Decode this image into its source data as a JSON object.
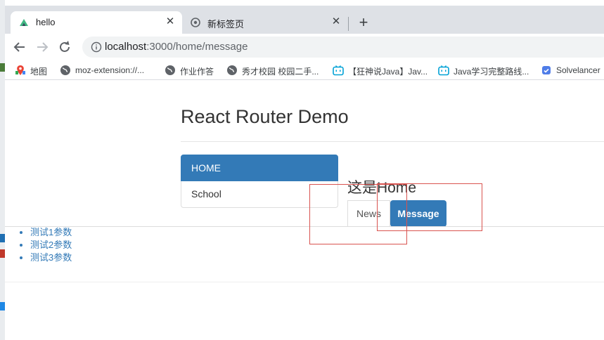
{
  "browser": {
    "tabs": [
      {
        "title": "hello",
        "active": true
      },
      {
        "title": "新标签页",
        "active": false
      }
    ],
    "close_glyph": "✕",
    "newtab_glyph": "+",
    "address": {
      "host": "localhost",
      "rest": ":3000/home/message"
    },
    "bookmarks": [
      {
        "label": "地图",
        "icon": "maps-icon"
      },
      {
        "label": "moz-extension://...",
        "icon": "globe-icon"
      },
      {
        "label": "作业作答",
        "icon": "globe-icon"
      },
      {
        "label": "秀才校园 校园二手...",
        "icon": "globe-icon"
      },
      {
        "label": "【狂神说Java】Jav...",
        "icon": "bilibili-icon"
      },
      {
        "label": "Java学习完整路线...",
        "icon": "bilibili-icon"
      },
      {
        "label": "Solvelancer",
        "icon": "solvelancer-icon"
      }
    ]
  },
  "page": {
    "title": "React Router Demo",
    "nav": [
      {
        "label": "HOME",
        "active": true
      },
      {
        "label": "School",
        "active": false
      }
    ],
    "home_heading": "这是Home",
    "sub_tabs": [
      {
        "label": "News",
        "active": false
      },
      {
        "label": "Message",
        "active": true
      }
    ],
    "messages": [
      "测试1参数",
      "测试2参数",
      "测试3参数"
    ]
  },
  "colors": {
    "primary": "#337ab7",
    "annotation_red": "#d9534f",
    "tabstrip": "#dee1e6"
  }
}
